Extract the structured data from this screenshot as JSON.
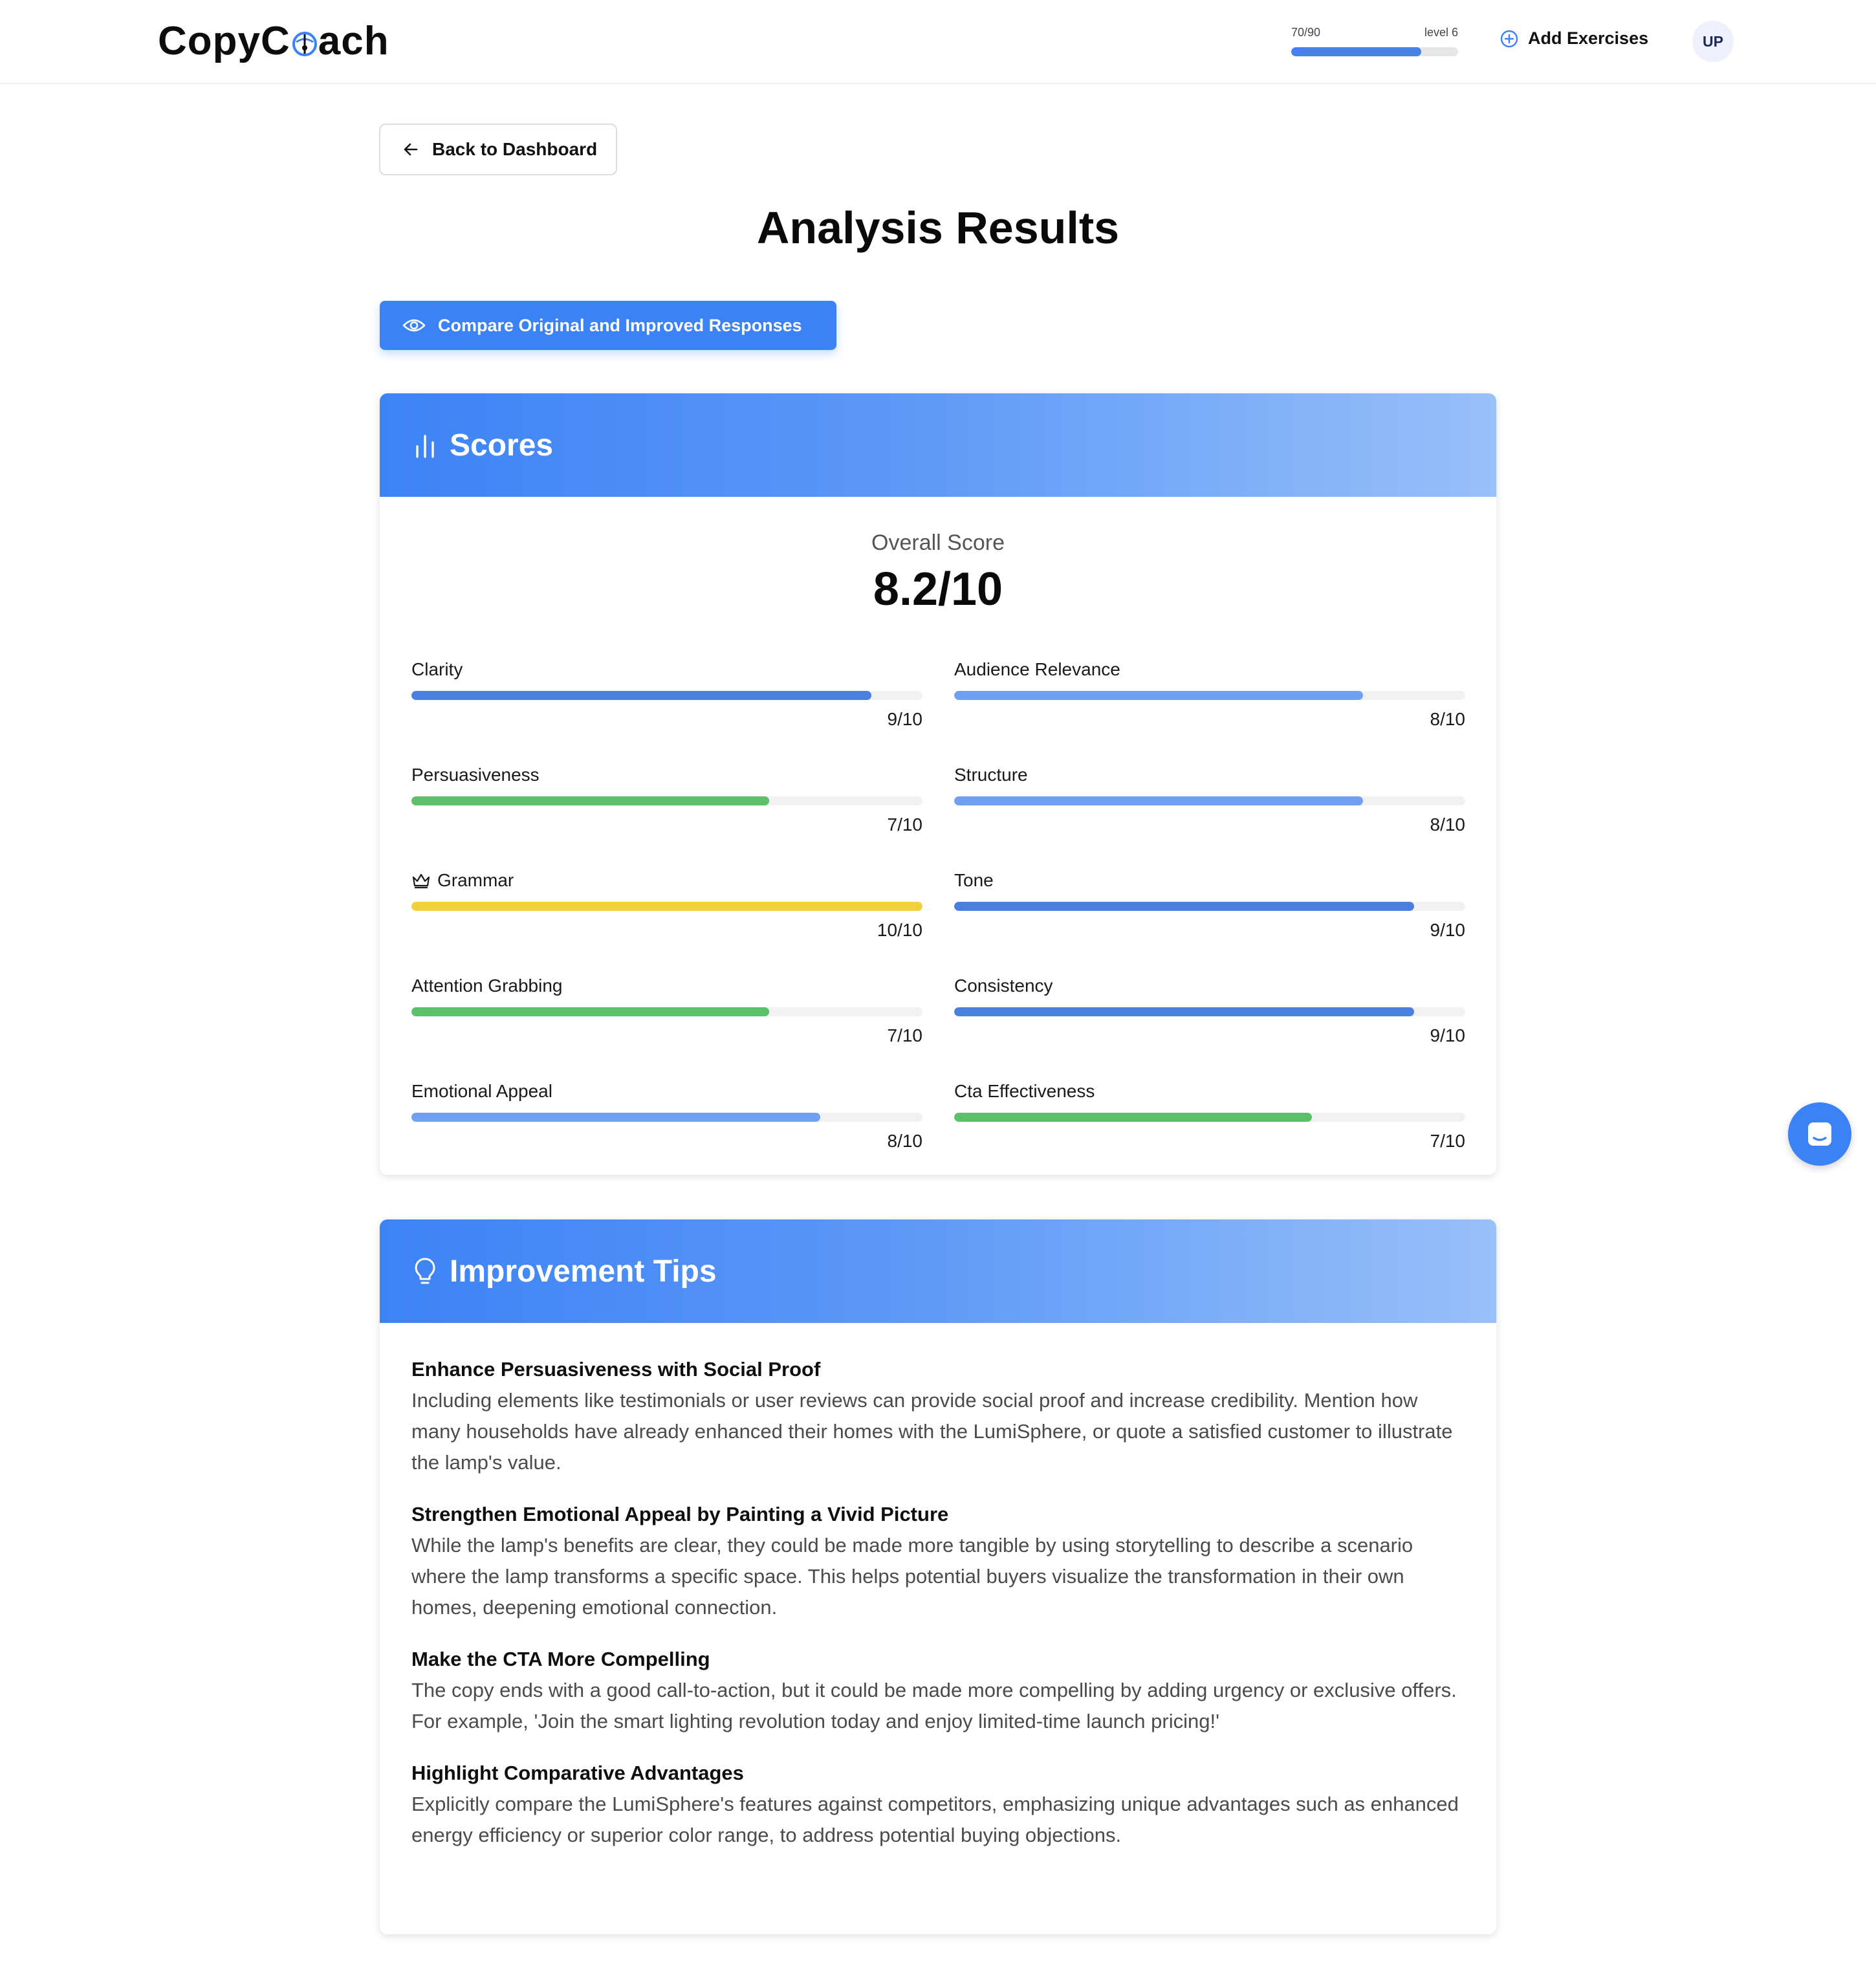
{
  "header": {
    "logo_prefix": "CopyC",
    "logo_suffix": "ach",
    "xp_current": "70/90",
    "level": "level 6",
    "xp_fraction": 0.78,
    "add_exercises": "Add Exercises",
    "avatar_initials": "UP"
  },
  "nav": {
    "back_label": "Back to Dashboard"
  },
  "page": {
    "title": "Analysis Results",
    "compare_label": "Compare Original and Improved Responses"
  },
  "scores": {
    "heading": "Scores",
    "overall_label": "Overall Score",
    "overall_value": "8.2/10",
    "metrics": [
      {
        "label": "Clarity",
        "value": "9/10",
        "score": 9,
        "color": "#4a7fe0"
      },
      {
        "label": "Audience Relevance",
        "value": "8/10",
        "score": 8,
        "color": "#6fa1f0"
      },
      {
        "label": "Persuasiveness",
        "value": "7/10",
        "score": 7,
        "color": "#5cbf69"
      },
      {
        "label": "Structure",
        "value": "8/10",
        "score": 8,
        "color": "#6fa1f0"
      },
      {
        "label": "Grammar",
        "value": "10/10",
        "score": 10,
        "color": "#f2cf3d",
        "icon": "crown-icon"
      },
      {
        "label": "Tone",
        "value": "9/10",
        "score": 9,
        "color": "#4a7fe0"
      },
      {
        "label": "Attention Grabbing",
        "value": "7/10",
        "score": 7,
        "color": "#5cbf69"
      },
      {
        "label": "Consistency",
        "value": "9/10",
        "score": 9,
        "color": "#4a7fe0"
      },
      {
        "label": "Emotional Appeal",
        "value": "8/10",
        "score": 8,
        "color": "#6fa1f0"
      },
      {
        "label": "Cta Effectiveness",
        "value": "7/10",
        "score": 7,
        "color": "#5cbf69"
      }
    ]
  },
  "tips": {
    "heading": "Improvement Tips",
    "items": [
      {
        "title": "Enhance Persuasiveness with Social Proof",
        "text": "Including elements like testimonials or user reviews can provide social proof and increase credibility. Mention how many households have already enhanced their homes with the LumiSphere, or quote a satisfied customer to illustrate the lamp's value."
      },
      {
        "title": "Strengthen Emotional Appeal by Painting a Vivid Picture",
        "text": "While the lamp's benefits are clear, they could be made more tangible by using storytelling to describe a scenario where the lamp transforms a specific space. This helps potential buyers visualize the transformation in their own homes, deepening emotional connection."
      },
      {
        "title": "Make the CTA More Compelling",
        "text": "The copy ends with a good call-to-action, but it could be made more compelling by adding urgency or exclusive offers. For example, 'Join the smart lighting revolution today and enjoy limited-time launch pricing!'"
      },
      {
        "title": "Highlight Comparative Advantages",
        "text": "Explicitly compare the LumiSphere's features against competitors, emphasizing unique advantages such as enhanced energy efficiency or superior color range, to address potential buying objections."
      }
    ]
  },
  "colors": {
    "accent": "#3b82f6",
    "blue_dark": "#4a7fe0",
    "blue_light": "#6fa1f0",
    "green": "#5cbf69",
    "yellow": "#f2cf3d"
  }
}
